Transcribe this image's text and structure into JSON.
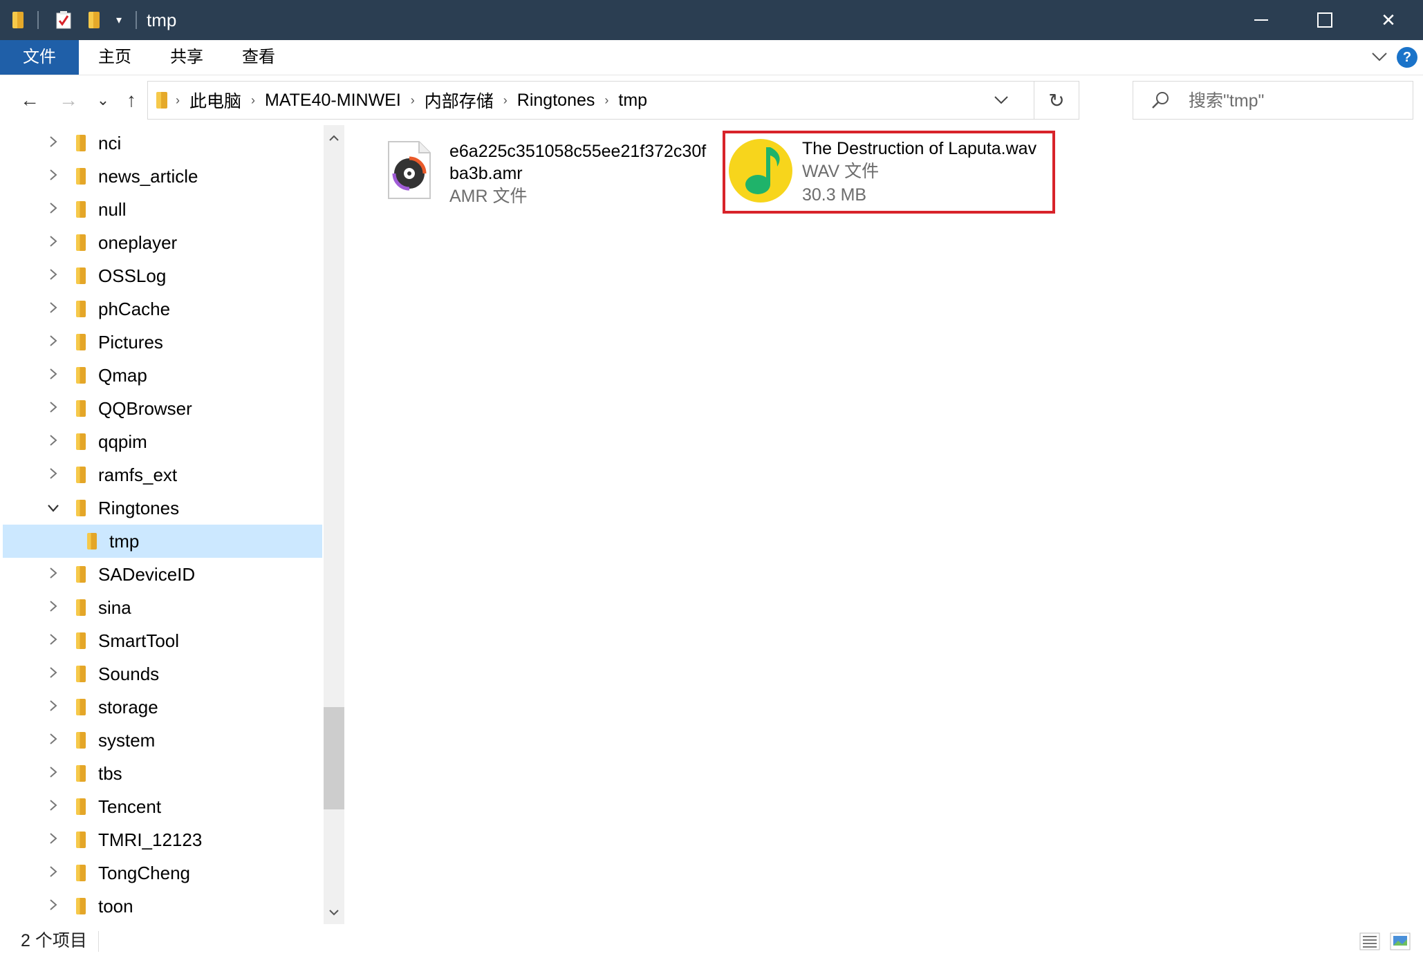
{
  "window": {
    "title": "tmp",
    "minimize_icon": "minimize-icon",
    "maximize_icon": "maximize-icon",
    "close_icon": "close-icon",
    "close_glyph": "✕"
  },
  "ribbon": {
    "tabs": [
      {
        "label": "文件"
      },
      {
        "label": "主页"
      },
      {
        "label": "共享"
      },
      {
        "label": "查看"
      }
    ],
    "help_label": "?"
  },
  "nav": {
    "back_glyph": "←",
    "forward_glyph": "→",
    "recent_glyph": "⌄",
    "up_glyph": "↑"
  },
  "address": {
    "crumbs": [
      "此电脑",
      "MATE40-MINWEI",
      "内部存储",
      "Ringtones",
      "tmp"
    ],
    "refresh_glyph": "↻",
    "dropdown_glyph": "⌄"
  },
  "search": {
    "placeholder": "搜索\"tmp\""
  },
  "tree": {
    "items": [
      {
        "label": "nci",
        "expanded": false
      },
      {
        "label": "news_article",
        "expanded": false
      },
      {
        "label": "null",
        "expanded": false
      },
      {
        "label": "oneplayer",
        "expanded": false
      },
      {
        "label": "OSSLog",
        "expanded": false
      },
      {
        "label": "phCache",
        "expanded": false
      },
      {
        "label": "Pictures",
        "expanded": false
      },
      {
        "label": "Qmap",
        "expanded": false
      },
      {
        "label": "QQBrowser",
        "expanded": false
      },
      {
        "label": "qqpim",
        "expanded": false
      },
      {
        "label": "ramfs_ext",
        "expanded": false
      },
      {
        "label": "Ringtones",
        "expanded": true
      },
      {
        "label": "tmp",
        "child": true,
        "selected": true
      },
      {
        "label": "SADeviceID",
        "expanded": false
      },
      {
        "label": "sina",
        "expanded": false
      },
      {
        "label": "SmartTool",
        "expanded": false
      },
      {
        "label": "Sounds",
        "expanded": false
      },
      {
        "label": "storage",
        "expanded": false
      },
      {
        "label": "system",
        "expanded": false
      },
      {
        "label": "tbs",
        "expanded": false
      },
      {
        "label": "Tencent",
        "expanded": false
      },
      {
        "label": "TMRI_12123",
        "expanded": false
      },
      {
        "label": "TongCheng",
        "expanded": false
      },
      {
        "label": "toon",
        "expanded": false
      }
    ]
  },
  "files": [
    {
      "name": "e6a225c351058c55ee21f372c30f\nba3b.amr",
      "type": "AMR 文件",
      "icon": "audio-disc-icon"
    },
    {
      "name": "The Destruction of Laputa.wav",
      "type": "WAV 文件",
      "size": "30.3 MB",
      "icon": "qq-music-icon"
    }
  ],
  "status": {
    "item_count": "2 个项目"
  },
  "colors": {
    "titlebar": "#2b3e52",
    "file_tab": "#1f5fa8",
    "selection": "#cce8ff",
    "highlight_border": "#d8232a"
  }
}
